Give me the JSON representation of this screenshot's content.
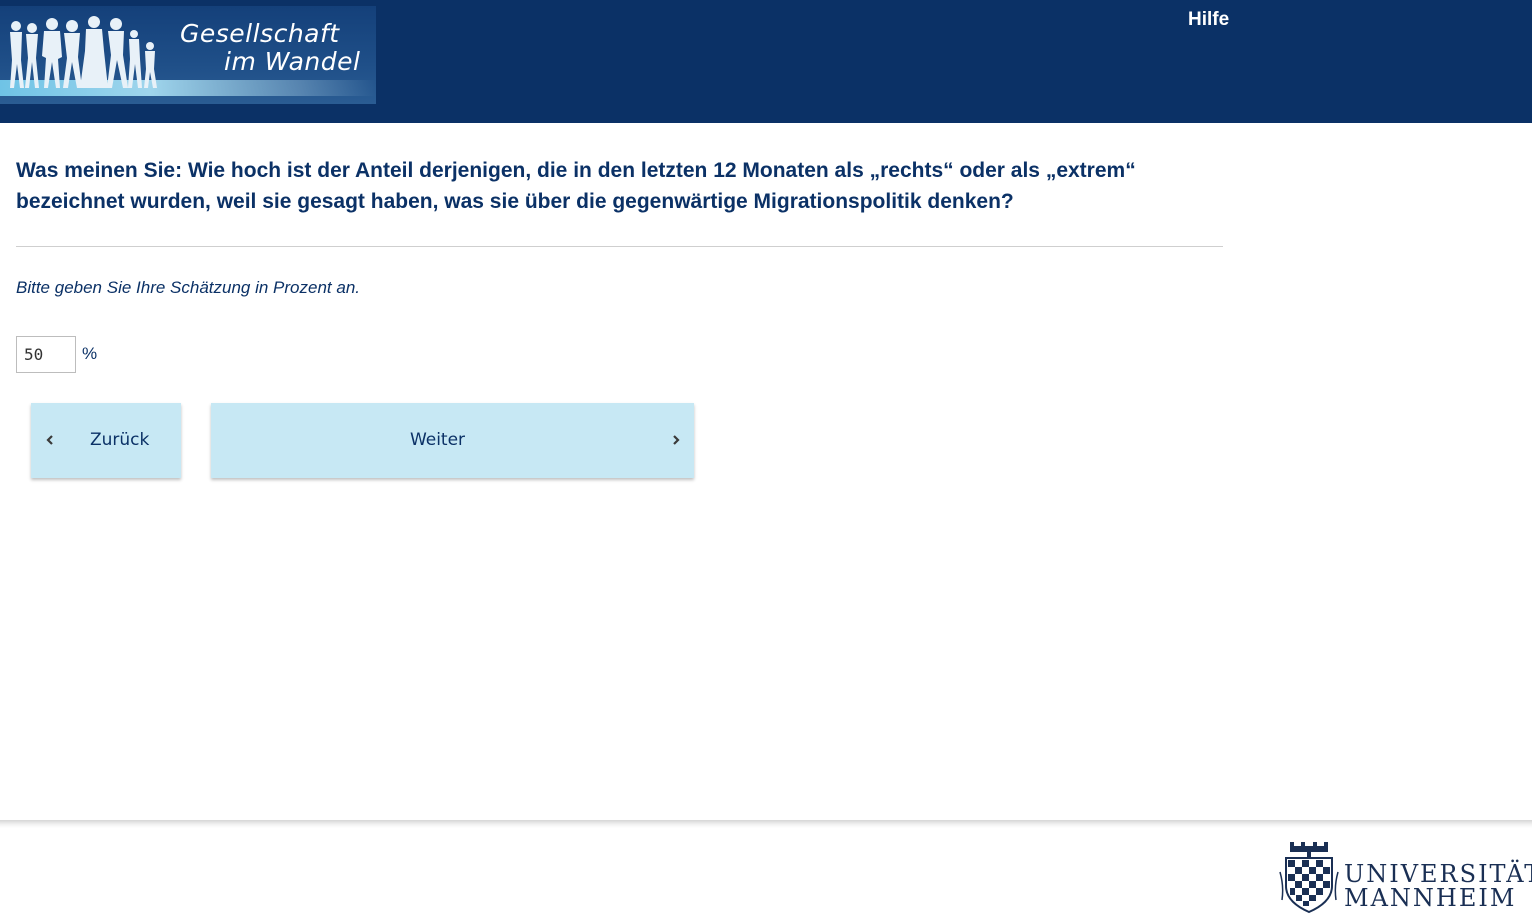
{
  "header": {
    "logo_line1": "Gesellschaft",
    "logo_line2": "im Wandel",
    "help_label": "Hilfe"
  },
  "question": {
    "text": "Was meinen Sie: Wie hoch ist der Anteil derjenigen, die in den letzten 12 Monaten als „rechts“ oder als „extrem“ bezeichnet wurden, weil sie gesagt haben, was sie über die gegenwärtige Migrationspolitik denken?",
    "instruction": "Bitte geben Sie Ihre Schätzung in Prozent an.",
    "answer_value": "50",
    "unit": "%"
  },
  "navigation": {
    "back_label": "Zurück",
    "next_label": "Weiter"
  },
  "footer": {
    "university_line1": "UNIVERSITÄT",
    "university_line2": "MANNHEIM"
  },
  "colors": {
    "header_bg": "#0b3166",
    "text_primary": "#0b3166",
    "button_bg": "#c7e8f4"
  },
  "icons": {
    "back": "chevron-left-icon",
    "next": "chevron-right-icon"
  }
}
